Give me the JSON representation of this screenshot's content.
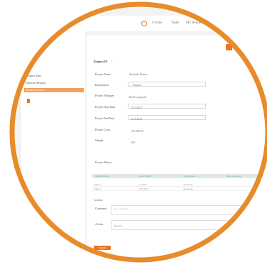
{
  "topbar": {
    "icon": "plus-circle-icon",
    "links": [
      "Circles",
      "Tasks",
      "My Requests"
    ]
  },
  "sidebar": {
    "items": [
      "Request Type",
      "Question Request",
      "Research Project"
    ],
    "active_index": 2
  },
  "form": {
    "header": "Request ID",
    "header_close": "×",
    "fields": [
      {
        "label": "Project Name",
        "value": "Multiple Phases"
      },
      {
        "label": "Department",
        "value": "Finance"
      },
      {
        "label": "Project Manager",
        "value": "Brad Longstaff"
      },
      {
        "label": "Project Start Date",
        "value": "11/1/2021"
      },
      {
        "label": "Project End Date",
        "value": "4/15/2022"
      },
      {
        "label": "Project Costs",
        "value": "135,000.00"
      },
      {
        "label": "Weight",
        "value": "100"
      }
    ],
    "phases_title": "Project Phases",
    "table": {
      "headers": [
        "Calendar Month",
        "Initial Period",
        "% Allocation",
        "Phase percentage"
      ],
      "rows": [
        [
          "Phase 1",
          "1/1/2021",
          "20 percent",
          ""
        ],
        [
          "Phase 2",
          "3/31/2021",
          "30 percent",
          ""
        ]
      ]
    },
    "actions_title": "Actions",
    "comment_label": "Comment",
    "comment_placeholder": "Type comment...",
    "action_label": "Action",
    "action_value": "Approve",
    "submit_label": "Submit"
  },
  "colors": {
    "accent": "#e87722",
    "ring": "#e88b2a"
  }
}
